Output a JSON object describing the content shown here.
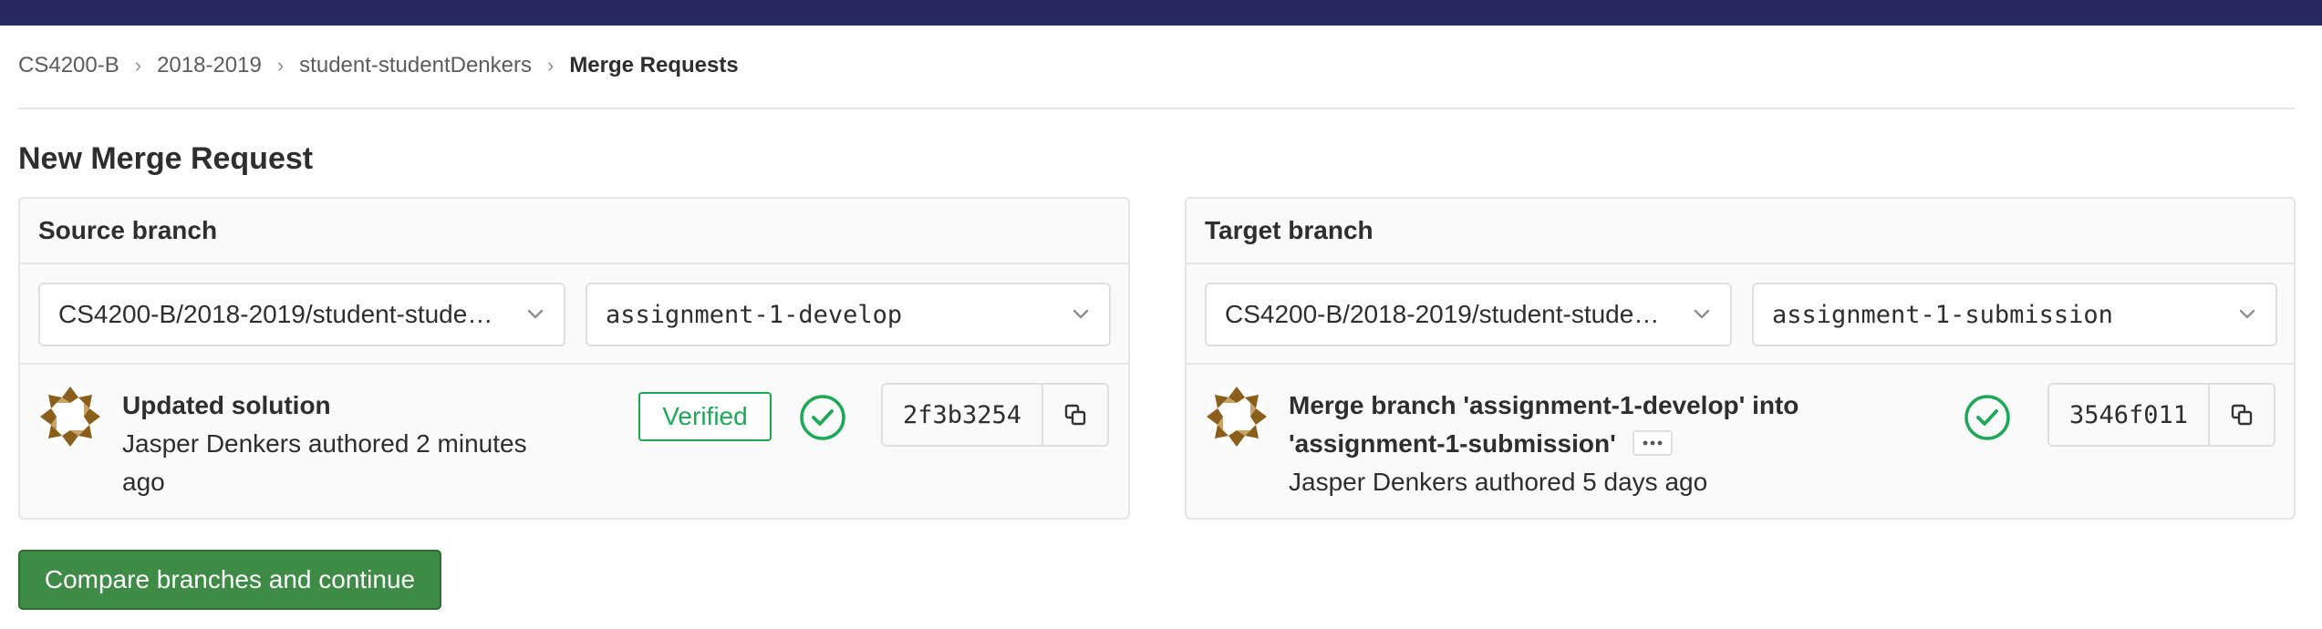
{
  "breadcrumb": {
    "items": [
      "CS4200-B",
      "2018-2019",
      "student-studentDenkers"
    ],
    "current": "Merge Requests"
  },
  "page": {
    "title": "New Merge Request"
  },
  "source": {
    "header": "Source branch",
    "project": "CS4200-B/2018-2019/student-stude…",
    "branch": "assignment-1-develop",
    "commit": {
      "title": "Updated solution",
      "meta_line1": "Jasper Denkers authored 2 minutes",
      "meta_line2": "ago",
      "badge": "Verified",
      "sha": "2f3b3254"
    }
  },
  "target": {
    "header": "Target branch",
    "project": "CS4200-B/2018-2019/student-stude…",
    "branch": "assignment-1-submission",
    "commit": {
      "title_line1": "Merge branch 'assignment-1-develop' into",
      "title_line2": "'assignment-1-submission'",
      "meta": "Jasper Denkers authored 5 days ago",
      "sha": "3546f011"
    }
  },
  "actions": {
    "compare_label": "Compare branches and continue"
  },
  "colors": {
    "topbar": "#292961",
    "success": "#1aaa55",
    "button": "#3d8b45"
  },
  "icons": [
    "chevron-right-icon",
    "chevron-down-icon",
    "check-circle-icon",
    "copy-icon",
    "ellipsis-icon",
    "avatar-icon"
  ]
}
